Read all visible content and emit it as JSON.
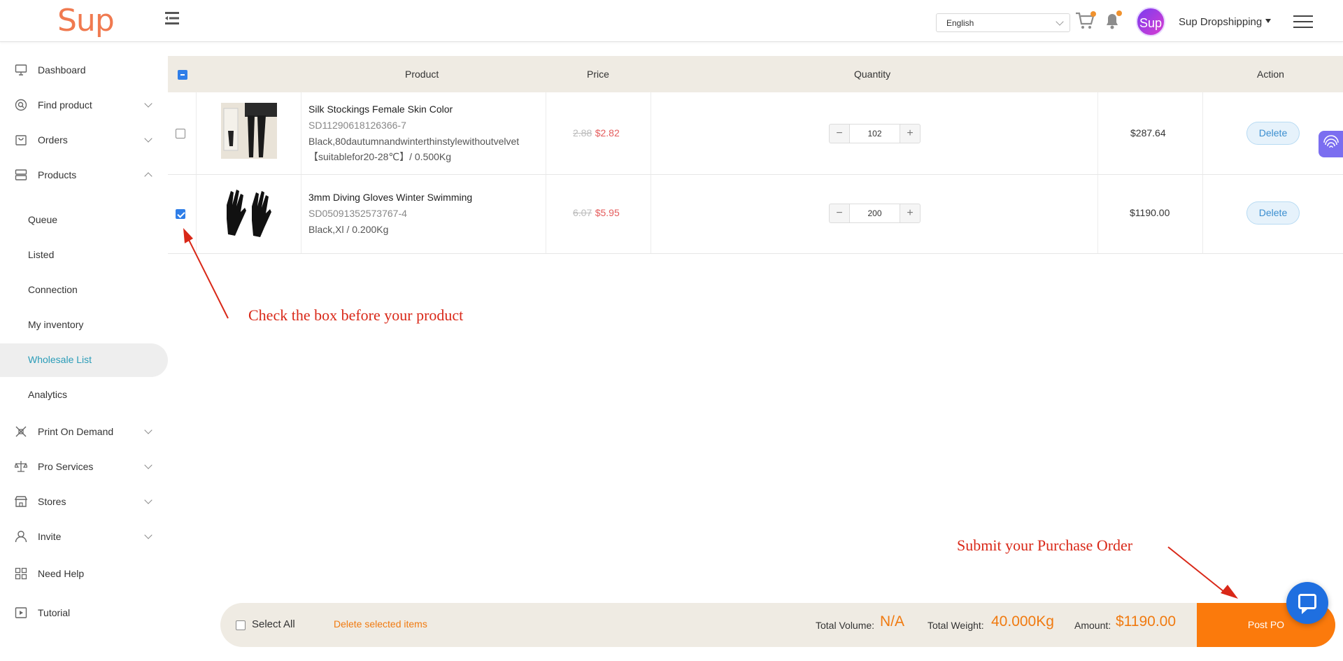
{
  "header": {
    "logo": "Sup",
    "language": "English",
    "avatar_text": "Sup",
    "user_name": "Sup Dropshipping"
  },
  "sidebar": {
    "items": [
      {
        "label": "Dashboard",
        "icon": "monitor-icon"
      },
      {
        "label": "Find product",
        "icon": "search-icon"
      },
      {
        "label": "Orders",
        "icon": "bag-icon"
      },
      {
        "label": "Products",
        "icon": "layers-icon"
      },
      {
        "label": "Print On Demand",
        "icon": "pen-tools-icon"
      },
      {
        "label": "Pro Services",
        "icon": "scale-icon"
      },
      {
        "label": "Stores",
        "icon": "store-icon"
      },
      {
        "label": "Invite",
        "icon": "user-icon"
      },
      {
        "label": "Need Help",
        "icon": "grid-icon"
      },
      {
        "label": "Tutorial",
        "icon": "video-icon"
      }
    ],
    "sub_items": [
      "Queue",
      "Listed",
      "Connection",
      "My inventory",
      "Wholesale List",
      "Analytics"
    ],
    "active_sub": "Wholesale List"
  },
  "table": {
    "headers": {
      "product": "Product",
      "price": "Price",
      "quantity": "Quantity",
      "action": "Action"
    },
    "rows": [
      {
        "name": "Silk Stockings Female Skin Color",
        "sku": "SD11290618126366-7",
        "variant_line1": "Black,80dautumnandwinterthinstylewithoutvelvet",
        "variant_line2": "【suitablefor20-28℃】/ 0.500Kg",
        "old_price": "2.88",
        "price": "$2.82",
        "quantity": "102",
        "subtotal": "$287.64",
        "action": "Delete",
        "checked": false
      },
      {
        "name": "3mm Diving Gloves Winter Swimming",
        "sku": "SD05091352573767-4",
        "variant_line1": "Black,Xl / 0.200Kg",
        "old_price": "6.07",
        "price": "$5.95",
        "quantity": "200",
        "subtotal": "$1190.00",
        "action": "Delete",
        "checked": true
      }
    ]
  },
  "annotations": {
    "check_box": "Check the box before your product",
    "submit": "Submit your Purchase Order"
  },
  "bottom_bar": {
    "select_all": "Select All",
    "delete_selected": "Delete selected items",
    "total_volume_label": "Total Volume:",
    "total_volume": "N/A",
    "total_weight_label": "Total Weight:",
    "total_weight": "40.000Kg",
    "amount_label": "Amount:",
    "amount": "$1190.00",
    "post_button": "Post PO"
  },
  "colors": {
    "accent_orange": "#fb7a0c",
    "active_teal": "#2a9cb8",
    "annotation_red": "#d92818",
    "price_red": "#e45c5c"
  }
}
